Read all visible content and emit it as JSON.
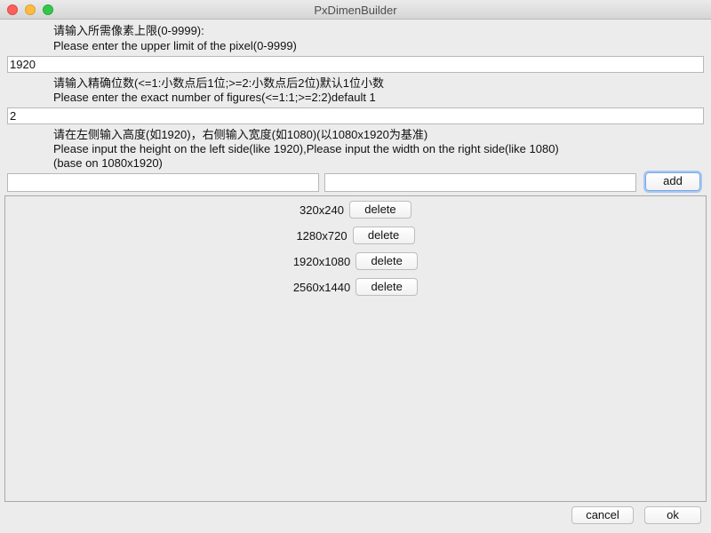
{
  "window": {
    "title": "PxDimenBuilder"
  },
  "upper_limit": {
    "label_cn": "请输入所需像素上限(0-9999):",
    "label_en": "Please enter the upper limit of the pixel(0-9999)",
    "value": "1920"
  },
  "precision": {
    "label_cn": "请输入精确位数(<=1:小数点后1位;>=2:小数点后2位)默认1位小数",
    "label_en": "Please enter the exact number of figures(<=1:1;>=2:2)default 1",
    "value": "2"
  },
  "dimension_input": {
    "label_cn": "请在左侧输入高度(如1920)，右侧输入宽度(如1080)(以1080x1920为基准)",
    "label_en": "Please input the height on the left side(like 1920),Please input the width on the right side(like 1080)",
    "label_en_2": "(base on 1080x1920)",
    "height_value": "",
    "width_value": "",
    "add_label": "add"
  },
  "dimensions": [
    {
      "label": "320x240",
      "delete_label": "delete"
    },
    {
      "label": "1280x720",
      "delete_label": "delete"
    },
    {
      "label": "1920x1080",
      "delete_label": "delete"
    },
    {
      "label": "2560x1440",
      "delete_label": "delete"
    }
  ],
  "footer": {
    "cancel_label": "cancel",
    "ok_label": "ok"
  },
  "colors": {
    "window_bg": "#ececec",
    "close": "#fc605b",
    "minimize": "#fdbc40",
    "maximize": "#34c84a",
    "focus_ring": "#a9c8f3"
  }
}
